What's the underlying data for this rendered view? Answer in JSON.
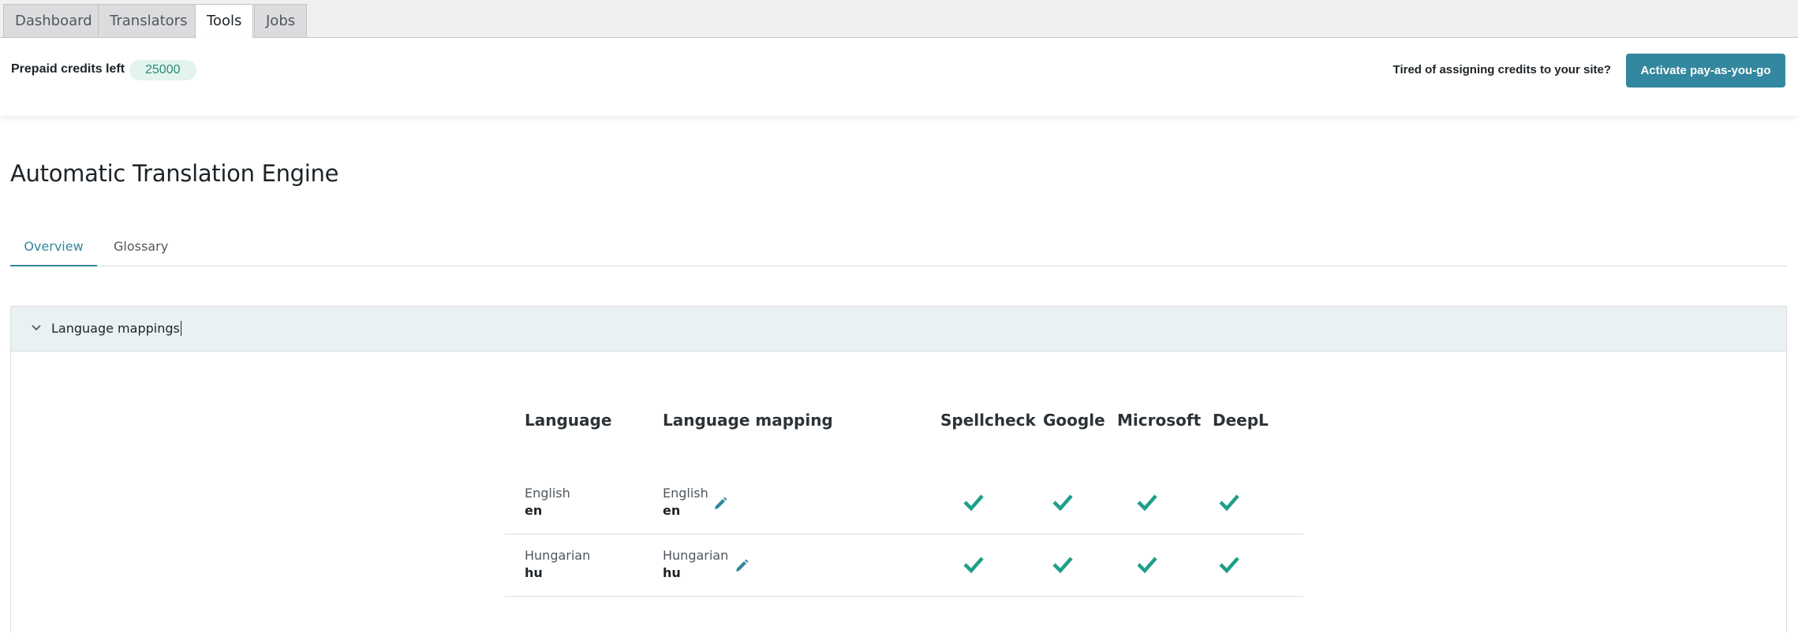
{
  "top_tabs": [
    {
      "label": "Dashboard",
      "active": false
    },
    {
      "label": "Translators",
      "active": false
    },
    {
      "label": "Tools",
      "active": true
    },
    {
      "label": "Jobs",
      "active": false
    }
  ],
  "credits": {
    "label": "Prepaid credits left",
    "value": "25000",
    "payg_question": "Tired of assigning credits to your site?",
    "payg_button": "Activate pay-as-you-go"
  },
  "page_title": "Automatic Translation Engine",
  "sub_tabs": [
    {
      "label": "Overview",
      "active": true
    },
    {
      "label": "Glossary",
      "active": false
    }
  ],
  "panel": {
    "title": "Language mappings",
    "expanded": true
  },
  "table": {
    "headers": [
      "Language",
      "Language mapping",
      "Spellcheck",
      "Google",
      "Microsoft",
      "DeepL"
    ],
    "rows": [
      {
        "language": "English",
        "code": "en",
        "mapping": "English",
        "mapping_code": "en",
        "spellcheck": true,
        "google": true,
        "microsoft": true,
        "deepl": true
      },
      {
        "language": "Hungarian",
        "code": "hu",
        "mapping": "Hungarian",
        "mapping_code": "hu",
        "spellcheck": true,
        "google": true,
        "microsoft": true,
        "deepl": true
      }
    ]
  },
  "colors": {
    "accent": "#33879e",
    "check": "#1e9f8b",
    "badge_bg": "#e3f4ef",
    "panel_header_bg": "#e9f1f3"
  },
  "icons": {
    "edit": "pencil-icon",
    "check": "check-icon",
    "collapse": "chevron-down-icon"
  }
}
